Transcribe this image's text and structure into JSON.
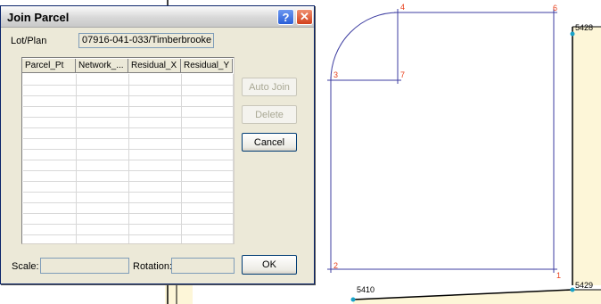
{
  "dialog": {
    "title": "Join Parcel",
    "lot_plan_label": "Lot/Plan",
    "lot_plan_value": "07916-041-033/Timberbrooke",
    "grid_columns": [
      "Parcel_Pt",
      "Network_...",
      "Residual_X",
      "Residual_Y"
    ],
    "grid_row_count": 16,
    "buttons": {
      "auto_join": "Auto Join",
      "delete": "Delete",
      "cancel": "Cancel",
      "ok": "OK"
    },
    "scale_label": "Scale:",
    "scale_value": "",
    "rotation_label": "Rotation:",
    "rotation_value": ""
  },
  "map": {
    "point_labels": [
      "1",
      "2",
      "3",
      "4",
      "6",
      "7"
    ],
    "parcel_labels": [
      "5428",
      "5410",
      "5429"
    ],
    "colors": {
      "parcel_line": "#3c3ca0",
      "point_label": "#e8401c",
      "vertex": "#1aa3c8",
      "parcel_fill": "#fdf6d8",
      "parcel_border": "#000000"
    }
  }
}
